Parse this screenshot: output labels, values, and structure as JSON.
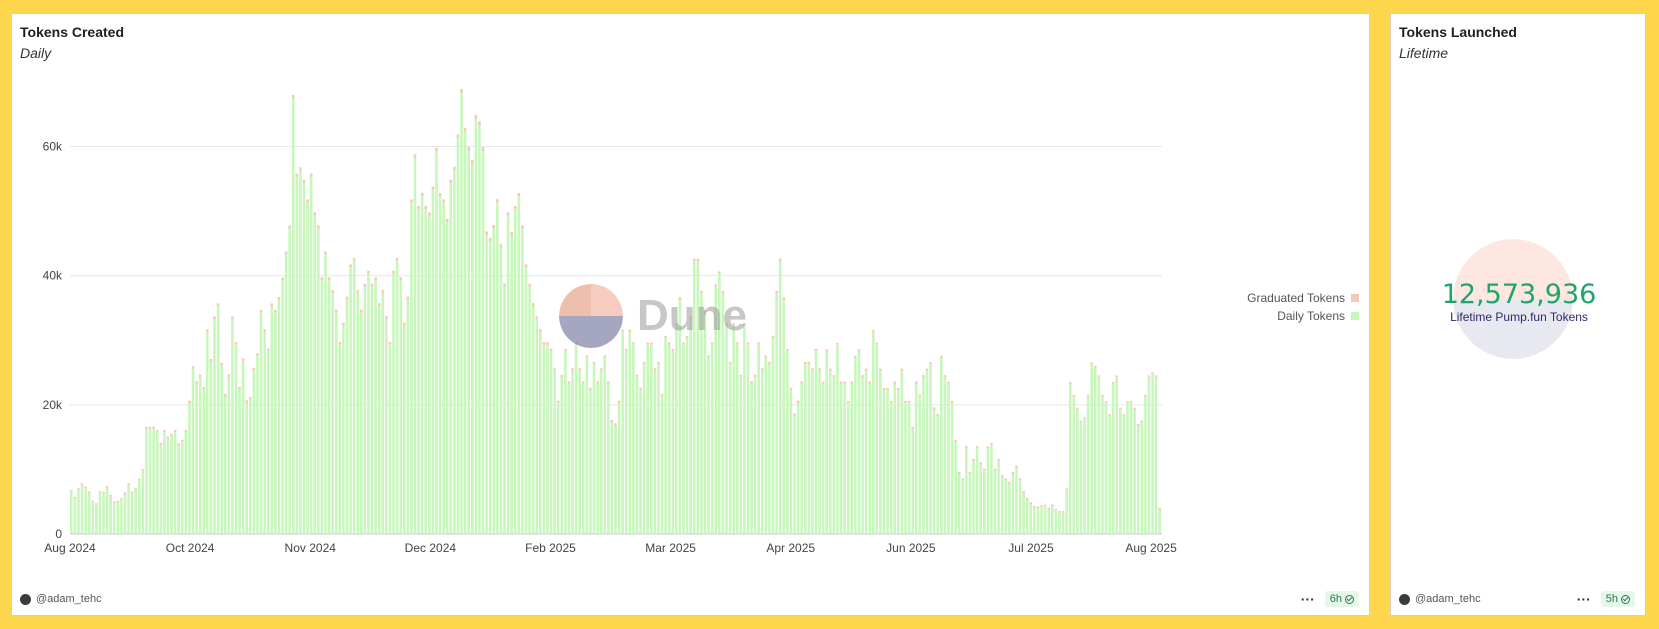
{
  "left_card": {
    "title": "Tokens Created",
    "subtitle": "Daily",
    "author": "@adam_tehc",
    "refresh": "6h"
  },
  "right_card": {
    "title": "Tokens Launched",
    "subtitle": "Lifetime",
    "value": "12,573,936",
    "value_label": "Lifetime Pump.fun Tokens",
    "author": "@adam_tehc",
    "refresh": "5h"
  },
  "watermark": "Dune",
  "colors": {
    "daily": "#c8f7bc",
    "graduated": "#f5c8b8",
    "grid": "#e8e8e8",
    "value": "#1ea56a",
    "label": "#2d2a6e",
    "background": "#fdd64c"
  },
  "icons": [
    "avatar-icon",
    "more-dots-icon",
    "check-circle-icon"
  ],
  "chart_data": {
    "type": "bar",
    "stacked": true,
    "title": "Tokens Created",
    "subtitle": "Daily",
    "x_ticks": [
      "Aug 2024",
      "Oct 2024",
      "Nov 2024",
      "Dec 2024",
      "Feb 2025",
      "Mar 2025",
      "Apr 2025",
      "Jun 2025",
      "Jul 2025",
      "Aug 2025"
    ],
    "y_ticks": [
      "0",
      "20k",
      "40k",
      "60k"
    ],
    "ylim": [
      0,
      72000
    ],
    "grid": true,
    "legend_position": "right",
    "series": [
      {
        "name": "Daily Tokens",
        "values": [
          6500,
          5500,
          6800,
          7600,
          7100,
          6300,
          4900,
          4500,
          6400,
          6300,
          7200,
          5800,
          4800,
          4900,
          5300,
          6200,
          7600,
          6300,
          6900,
          8300,
          9800,
          16300,
          16300,
          16300,
          15800,
          13800,
          15800,
          14800,
          15200,
          15800,
          13700,
          14300,
          15800,
          20300,
          25600,
          23300,
          24300,
          22400,
          31300,
          26700,
          33300,
          35300,
          26100,
          21300,
          24300,
          33300,
          29300,
          22400,
          26800,
          20300,
          20800,
          25300,
          27600,
          34300,
          31300,
          28300,
          35300,
          34300,
          36300,
          39300,
          43300,
          47300,
          67500,
          55300,
          56300,
          54300,
          51300,
          55300,
          49300,
          47300,
          39300,
          43300,
          39300,
          37300,
          34300,
          29300,
          32300,
          36300,
          41300,
          42300,
          37300,
          34300,
          38300,
          40300,
          38300,
          39300,
          35300,
          37300,
          33300,
          29300,
          40300,
          42300,
          39300,
          32300,
          36300,
          51300,
          58300,
          50300,
          52300,
          50300,
          49300,
          53300,
          59300,
          52300,
          51300,
          48300,
          54300,
          56300,
          61300,
          68300,
          62300,
          59300,
          57300,
          64300,
          63300,
          59300,
          46300,
          45300,
          47300,
          51300,
          44300,
          38300,
          49300,
          46300,
          50300,
          52300,
          47300,
          41300,
          38300,
          35300,
          33300,
          31300,
          29300,
          29300,
          28300,
          25300,
          20300,
          24300,
          28300,
          23300,
          25300,
          29300,
          25300,
          23300,
          27300,
          22300,
          26300,
          23300,
          25300,
          27300,
          23300,
          17300,
          16800,
          20300,
          31300,
          28300,
          31300,
          29300,
          24300,
          22300,
          26300,
          29300,
          29300,
          25300,
          26300,
          21300,
          30300,
          29300,
          28300,
          32300,
          36300,
          29300,
          30300,
          33300,
          42300,
          42300,
          37300,
          34300,
          27300,
          29300,
          38300,
          40300,
          37300,
          32300,
          26300,
          32300,
          29300,
          24300,
          32300,
          29300,
          23300,
          24300,
          29300,
          25300,
          27300,
          26300,
          30300,
          37300,
          42300,
          36300,
          28300,
          22300,
          18300,
          20300,
          23300,
          26300,
          26300,
          25300,
          28300,
          25300,
          23300,
          28300,
          25300,
          24300,
          29300,
          23300,
          23300,
          20300,
          23300,
          27300,
          28300,
          24300,
          25300,
          23300,
          31300,
          29300,
          25300,
          22300,
          22300,
          20300,
          23300,
          22300,
          25300,
          20300,
          20300,
          16300,
          23300,
          21300,
          24300,
          25300,
          26300,
          19300,
          18300,
          27300,
          24300,
          23300,
          20300,
          14300,
          9300,
          8300,
          13300,
          9300,
          11300,
          13300,
          10800,
          9800,
          13300,
          13800,
          9800,
          11300,
          8800,
          8300,
          7800,
          9300,
          10300,
          8300,
          6300,
          5300,
          4600,
          4100,
          4000,
          4200,
          4300,
          3800,
          4300,
          3600,
          3300,
          3300,
          6800,
          23300,
          21300,
          19300,
          17300,
          17800,
          21300,
          26300,
          25800,
          24300,
          21300,
          20300,
          18300,
          23300,
          24300,
          19300,
          18300,
          20300,
          20300,
          19300,
          16800,
          17300,
          21300,
          24300,
          24800,
          24300,
          3800
        ]
      },
      {
        "name": "Graduated Tokens",
        "values": [
          250,
          250,
          250,
          250,
          250,
          250,
          250,
          250,
          250,
          250,
          250,
          250,
          250,
          250,
          250,
          250,
          250,
          250,
          250,
          250,
          250,
          300,
          300,
          300,
          300,
          300,
          300,
          300,
          300,
          300,
          300,
          300,
          300,
          350,
          350,
          350,
          350,
          350,
          400,
          400,
          400,
          400,
          400,
          400,
          400,
          400,
          400,
          400,
          400,
          400,
          400,
          400,
          400,
          400,
          400,
          400,
          400,
          400,
          400,
          400,
          450,
          450,
          500,
          500,
          500,
          500,
          500,
          500,
          500,
          500,
          450,
          450,
          450,
          450,
          450,
          450,
          450,
          450,
          450,
          450,
          450,
          450,
          450,
          450,
          450,
          450,
          450,
          450,
          450,
          450,
          450,
          450,
          450,
          450,
          450,
          500,
          500,
          500,
          500,
          500,
          500,
          500,
          500,
          500,
          500,
          500,
          550,
          550,
          550,
          600,
          600,
          600,
          600,
          600,
          600,
          600,
          550,
          550,
          550,
          550,
          550,
          500,
          500,
          500,
          500,
          500,
          500,
          450,
          450,
          450,
          400,
          400,
          400,
          400,
          400,
          350,
          350,
          350,
          350,
          350,
          350,
          350,
          350,
          350,
          350,
          350,
          350,
          350,
          350,
          350,
          350,
          350,
          350,
          350,
          350,
          350,
          350,
          350,
          350,
          350,
          350,
          350,
          350,
          350,
          350,
          350,
          350,
          350,
          350,
          350,
          350,
          350,
          350,
          350,
          350,
          350,
          350,
          350,
          350,
          350,
          350,
          350,
          350,
          350,
          350,
          350,
          350,
          350,
          350,
          350,
          350,
          350,
          350,
          350,
          350,
          350,
          350,
          350,
          350,
          350,
          350,
          350,
          350,
          350,
          350,
          350,
          350,
          350,
          350,
          350,
          300,
          300,
          300,
          300,
          300,
          300,
          300,
          300,
          300,
          300,
          300,
          300,
          300,
          300,
          300,
          300,
          300,
          300,
          300,
          300,
          300,
          300,
          300,
          300,
          300,
          300,
          300,
          300,
          300,
          300,
          300,
          300,
          300,
          300,
          300,
          300,
          300,
          300,
          300,
          300,
          300,
          300,
          300,
          300,
          300,
          300,
          300,
          300,
          300,
          300,
          300,
          300,
          300,
          300,
          300,
          300,
          300,
          300,
          300,
          250,
          250,
          250,
          250,
          250,
          250,
          250,
          250,
          250,
          250,
          250,
          250,
          250,
          250,
          250,
          250,
          250,
          250,
          250,
          250,
          250,
          250,
          250,
          250,
          250,
          250,
          250,
          250,
          250,
          250,
          250,
          250,
          250,
          250,
          250,
          250,
          250,
          250,
          250,
          250,
          250,
          250,
          250,
          250,
          250,
          250,
          250,
          250,
          250,
          250,
          250,
          250,
          250,
          250,
          250,
          250,
          250,
          250,
          250,
          250,
          250
        ]
      }
    ]
  }
}
